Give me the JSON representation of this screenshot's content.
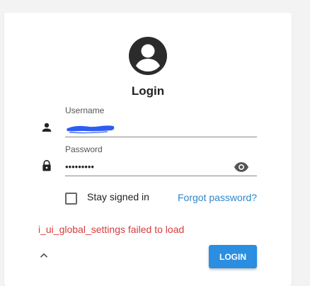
{
  "login": {
    "title": "Login",
    "username_label": "Username",
    "username_value": "",
    "password_label": "Password",
    "password_value": "•••••••••",
    "stay_signed_in_label": "Stay signed in",
    "stay_signed_in_checked": false,
    "forgot_password": "Forgot password?",
    "error_message": "i_ui_global_settings failed to load",
    "login_button": "LOGIN"
  },
  "icons": {
    "avatar": "account-circle-icon",
    "username": "person-icon",
    "password": "lock-icon",
    "show_password": "eye-icon",
    "collapse": "chevron-up-icon"
  },
  "colors": {
    "accent": "#2b8ee0",
    "link": "#2e87c9",
    "error": "#d63d3d"
  }
}
